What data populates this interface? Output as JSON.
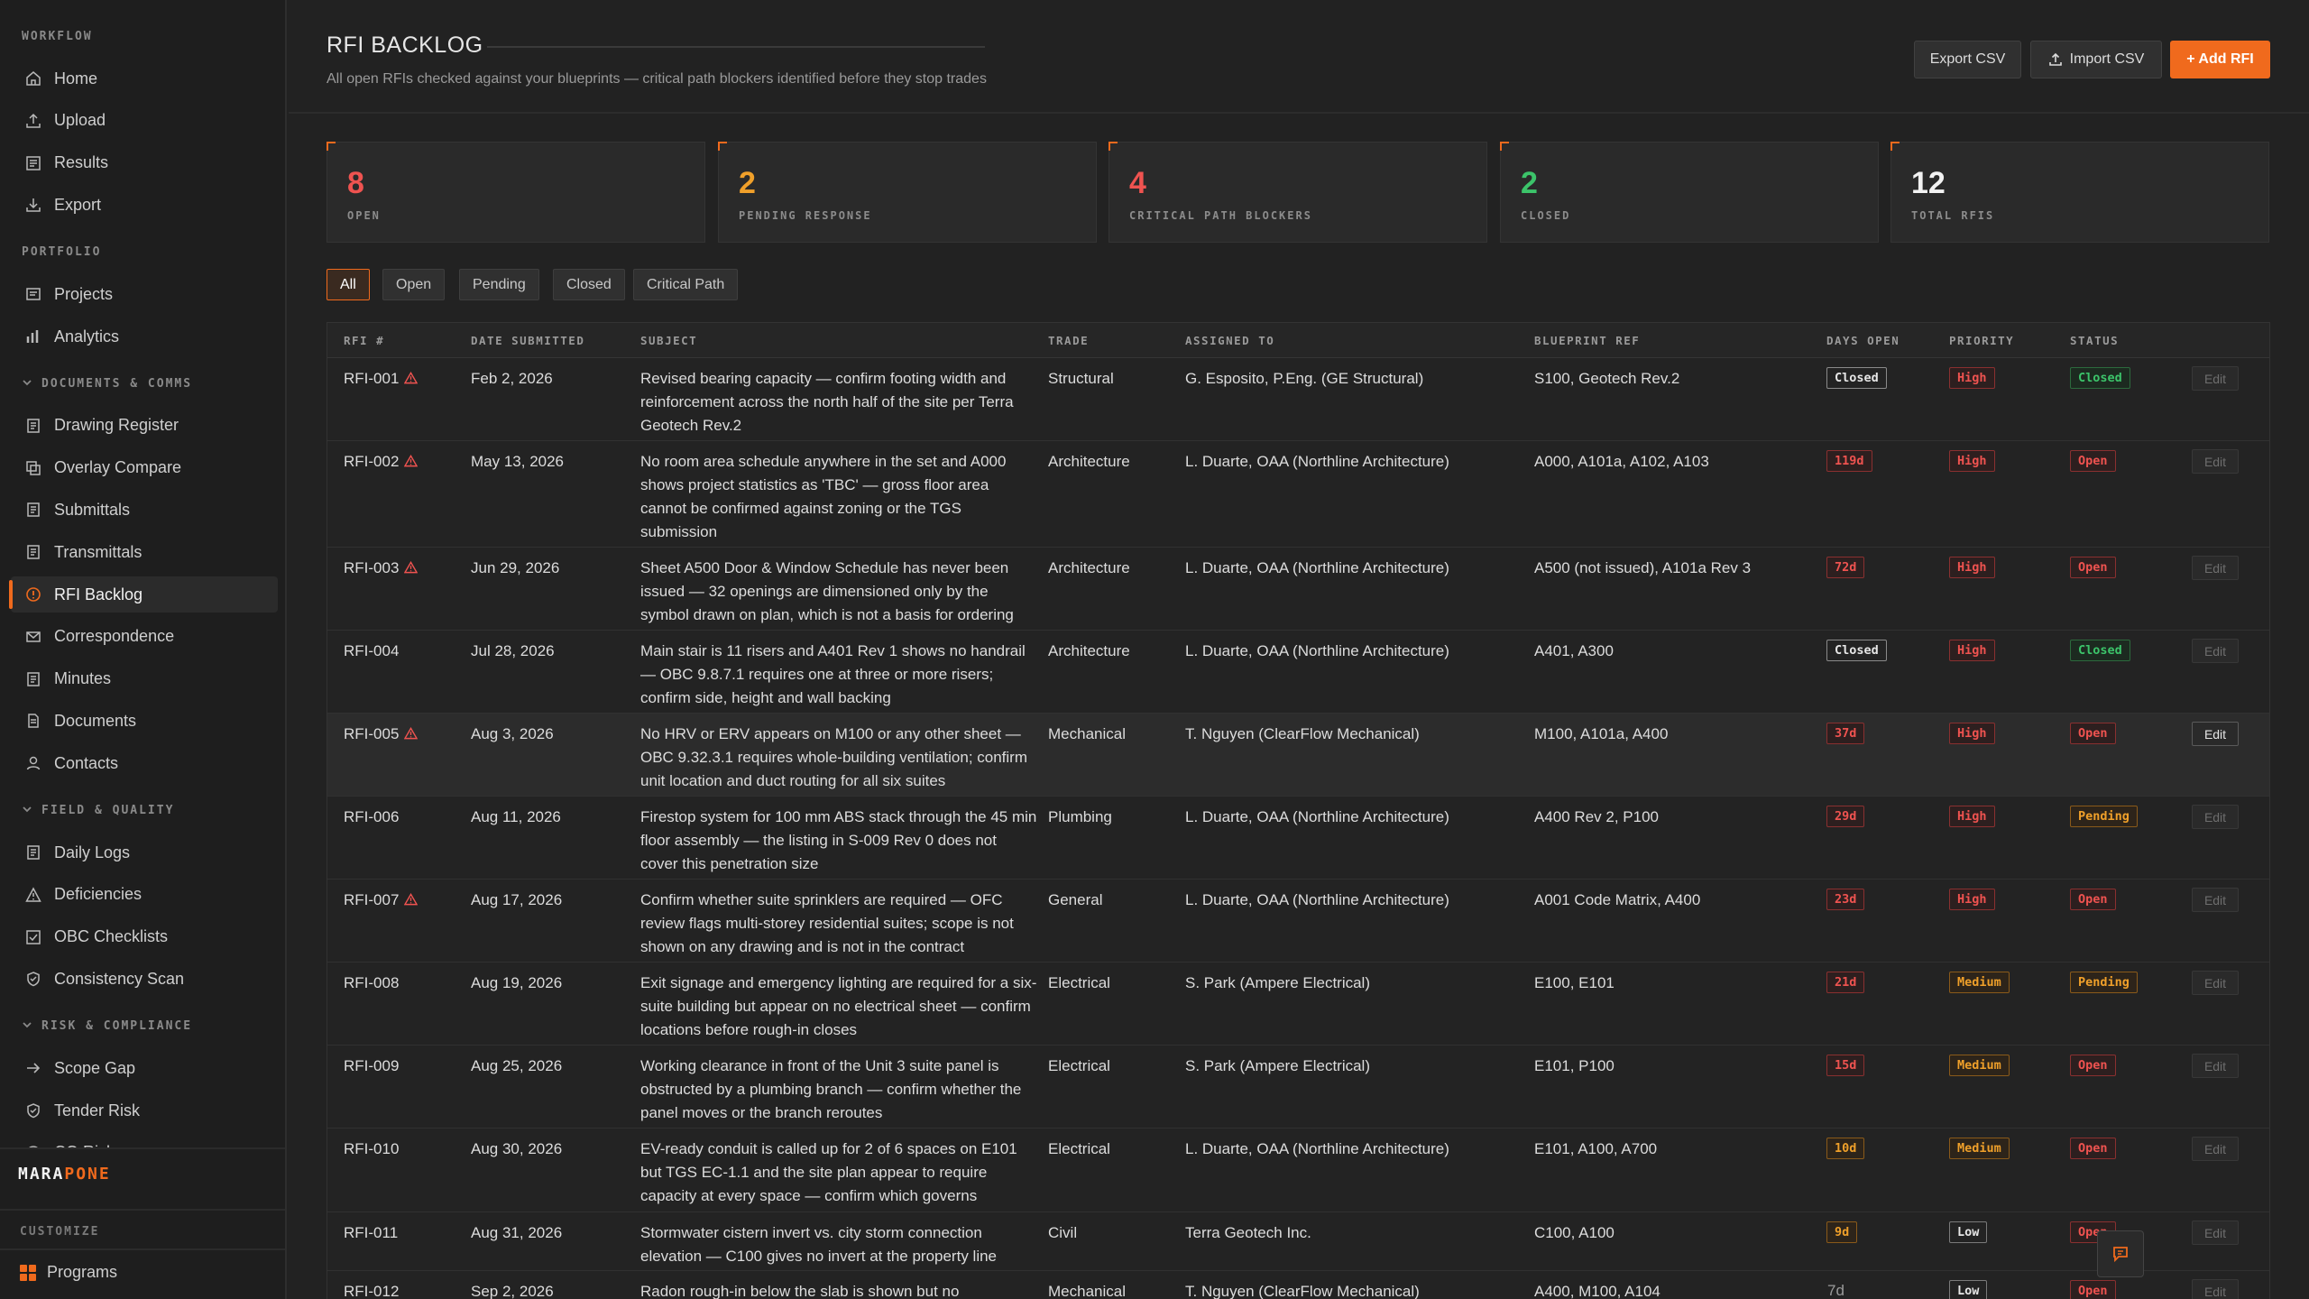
{
  "sidebar": {
    "sections": [
      {
        "title": "WORKFLOW",
        "collapsible": false,
        "items": [
          {
            "label": "Home",
            "icon": "home-icon"
          },
          {
            "label": "Upload",
            "icon": "upload-icon"
          },
          {
            "label": "Results",
            "icon": "results-icon"
          },
          {
            "label": "Export",
            "icon": "export-icon"
          }
        ]
      },
      {
        "title": "PORTFOLIO",
        "collapsible": false,
        "items": [
          {
            "label": "Projects",
            "icon": "projects-icon"
          },
          {
            "label": "Analytics",
            "icon": "bar-chart-icon"
          }
        ]
      },
      {
        "title": "DOCUMENTS & COMMS",
        "collapsible": true,
        "items": [
          {
            "label": "Drawing Register",
            "icon": "document-icon"
          },
          {
            "label": "Overlay Compare",
            "icon": "overlay-icon"
          },
          {
            "label": "Submittals",
            "icon": "document-icon"
          },
          {
            "label": "Transmittals",
            "icon": "document-icon"
          },
          {
            "label": "RFI Backlog",
            "icon": "info-circle-icon",
            "active": true
          },
          {
            "label": "Correspondence",
            "icon": "mail-icon"
          },
          {
            "label": "Minutes",
            "icon": "document-icon"
          },
          {
            "label": "Documents",
            "icon": "file-icon"
          },
          {
            "label": "Contacts",
            "icon": "person-icon"
          }
        ]
      },
      {
        "title": "FIELD & QUALITY",
        "collapsible": true,
        "items": [
          {
            "label": "Daily Logs",
            "icon": "document-icon"
          },
          {
            "label": "Deficiencies",
            "icon": "warning-icon"
          },
          {
            "label": "OBC Checklists",
            "icon": "checklist-icon"
          },
          {
            "label": "Consistency Scan",
            "icon": "shield-check-icon"
          }
        ]
      },
      {
        "title": "RISK & COMPLIANCE",
        "collapsible": true,
        "items": [
          {
            "label": "Scope Gap",
            "icon": "arrow-right-icon"
          },
          {
            "label": "Tender Risk",
            "icon": "shield-icon"
          },
          {
            "label": "CO Risk",
            "icon": "clock-icon"
          }
        ]
      }
    ],
    "brand_part1": "MARA",
    "brand_part2": "PONE",
    "customize_label": "CUSTOMIZE",
    "programs_label": "Programs"
  },
  "header": {
    "title": "RFI BACKLOG",
    "subtitle": "All open RFIs checked against your blueprints — critical path blockers identified before they stop trades",
    "export_label": "Export CSV",
    "import_label": "Import CSV",
    "add_label": "+ Add RFI"
  },
  "stats": [
    {
      "value": "8",
      "label": "OPEN",
      "color": "#ef5350"
    },
    {
      "value": "2",
      "label": "PENDING RESPONSE",
      "color": "#f0a02a"
    },
    {
      "value": "4",
      "label": "CRITICAL PATH BLOCKERS",
      "color": "#ef5350"
    },
    {
      "value": "2",
      "label": "CLOSED",
      "color": "#3cc46a"
    },
    {
      "value": "12",
      "label": "TOTAL RFIS",
      "color": "#f2f2f2"
    }
  ],
  "filters": [
    {
      "label": "All",
      "active": true
    },
    {
      "label": "Open"
    },
    {
      "label": "Pending"
    },
    {
      "label": "Closed"
    },
    {
      "label": "Critical Path"
    }
  ],
  "table": {
    "columns": [
      "RFI #",
      "DATE SUBMITTED",
      "SUBJECT",
      "TRADE",
      "ASSIGNED TO",
      "BLUEPRINT REF",
      "DAYS OPEN",
      "PRIORITY",
      "STATUS"
    ],
    "edit_label": "Edit",
    "rows": [
      {
        "id": "RFI-001",
        "critical": true,
        "date": "Feb 2, 2026",
        "subject": "Revised bearing capacity — confirm footing width and reinforcement across the north half of the site per Terra Geotech Rev.2",
        "trade": "Structural",
        "assigned": "G. Esposito, P.Eng. (GE Structural)",
        "ref": "S100, Geotech Rev.2",
        "days": "Closed",
        "days_style": "closed",
        "priority": "High",
        "status": "Closed"
      },
      {
        "id": "RFI-002",
        "critical": true,
        "date": "May 13, 2026",
        "subject": "No room area schedule anywhere in the set and A000 shows project statistics as 'TBC' — gross floor area cannot be confirmed against zoning or the TGS submission",
        "trade": "Architecture",
        "assigned": "L. Duarte, OAA (Northline Architecture)",
        "ref": "A000, A101a, A102, A103",
        "days": "119d",
        "days_style": "red",
        "priority": "High",
        "status": "Open"
      },
      {
        "id": "RFI-003",
        "critical": true,
        "date": "Jun 29, 2026",
        "subject": "Sheet A500 Door & Window Schedule has never been issued — 32 openings are dimensioned only by the symbol drawn on plan, which is not a basis for ordering",
        "trade": "Architecture",
        "assigned": "L. Duarte, OAA (Northline Architecture)",
        "ref": "A500 (not issued), A101a Rev 3",
        "days": "72d",
        "days_style": "red",
        "priority": "High",
        "status": "Open"
      },
      {
        "id": "RFI-004",
        "critical": false,
        "date": "Jul 28, 2026",
        "subject": "Main stair is 11 risers and A401 Rev 1 shows no handrail — OBC 9.8.7.1 requires one at three or more risers; confirm side, height and wall backing",
        "trade": "Architecture",
        "assigned": "L. Duarte, OAA (Northline Architecture)",
        "ref": "A401, A300",
        "days": "Closed",
        "days_style": "closed",
        "priority": "High",
        "status": "Closed"
      },
      {
        "id": "RFI-005",
        "critical": true,
        "date": "Aug 3, 2026",
        "subject": "No HRV or ERV appears on M100 or any other sheet — OBC 9.32.3.1 requires whole-building ventilation; confirm unit location and duct routing for all six suites",
        "trade": "Mechanical",
        "assigned": "T. Nguyen (ClearFlow Mechanical)",
        "ref": "M100, A101a, A400",
        "days": "37d",
        "days_style": "red",
        "priority": "High",
        "status": "Open",
        "highlight": true
      },
      {
        "id": "RFI-006",
        "critical": false,
        "date": "Aug 11, 2026",
        "subject": "Firestop system for 100 mm ABS stack through the 45 min floor assembly — the listing in S-009 Rev 0 does not cover this penetration size",
        "trade": "Plumbing",
        "assigned": "L. Duarte, OAA (Northline Architecture)",
        "ref": "A400 Rev 2, P100",
        "days": "29d",
        "days_style": "red",
        "priority": "High",
        "status": "Pending"
      },
      {
        "id": "RFI-007",
        "critical": true,
        "date": "Aug 17, 2026",
        "subject": "Confirm whether suite sprinklers are required — OFC review flags multi-storey residential suites; scope is not shown on any drawing and is not in the contract",
        "trade": "General",
        "assigned": "L. Duarte, OAA (Northline Architecture)",
        "ref": "A001 Code Matrix, A400",
        "days": "23d",
        "days_style": "red",
        "priority": "High",
        "status": "Open"
      },
      {
        "id": "RFI-008",
        "critical": false,
        "date": "Aug 19, 2026",
        "subject": "Exit signage and emergency lighting are required for a six-suite building but appear on no electrical sheet — confirm locations before rough-in closes",
        "trade": "Electrical",
        "assigned": "S. Park (Ampere Electrical)",
        "ref": "E100, E101",
        "days": "21d",
        "days_style": "red",
        "priority": "Medium",
        "status": "Pending"
      },
      {
        "id": "RFI-009",
        "critical": false,
        "date": "Aug 25, 2026",
        "subject": "Working clearance in front of the Unit 3 suite panel is obstructed by a plumbing branch — confirm whether the panel moves or the branch reroutes",
        "trade": "Electrical",
        "assigned": "S. Park (Ampere Electrical)",
        "ref": "E101, P100",
        "days": "15d",
        "days_style": "red",
        "priority": "Medium",
        "status": "Open"
      },
      {
        "id": "RFI-010",
        "critical": false,
        "date": "Aug 30, 2026",
        "subject": "EV-ready conduit is called up for 2 of 6 spaces on E101 but TGS EC-1.1 and the site plan appear to require capacity at every space — confirm which governs",
        "trade": "Electrical",
        "assigned": "L. Duarte, OAA (Northline Architecture)",
        "ref": "E101, A100, A700",
        "days": "10d",
        "days_style": "orange",
        "priority": "Medium",
        "status": "Open"
      },
      {
        "id": "RFI-011",
        "critical": false,
        "date": "Aug 31, 2026",
        "subject": "Stormwater cistern invert vs. city storm connection elevation — C100 gives no invert at the property line",
        "trade": "Civil",
        "assigned": "Terra Geotech Inc.",
        "ref": "C100, A100",
        "days": "9d",
        "days_style": "orange",
        "priority": "Low",
        "status": "Open"
      },
      {
        "id": "RFI-012",
        "critical": false,
        "date": "Sep 2, 2026",
        "subject": "Radon rough-in below the slab is shown but no",
        "trade": "Mechanical",
        "assigned": "T. Nguyen (ClearFlow Mechanical)",
        "ref": "A400, M100, A104",
        "days": "7d",
        "days_style": "plain",
        "priority": "Low",
        "status": "Open"
      }
    ]
  },
  "colors": {
    "accent": "#f06a1d",
    "red": "#ef5350",
    "orange": "#f0a02a",
    "green": "#3cc46a"
  }
}
